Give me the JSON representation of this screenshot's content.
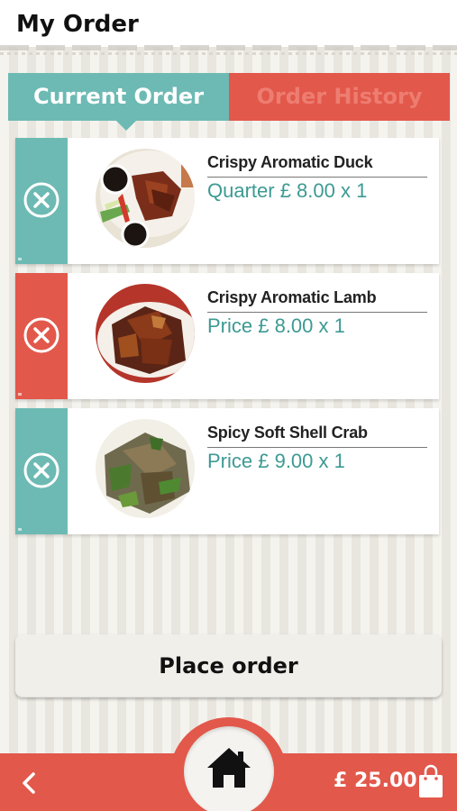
{
  "header": {
    "title": "My Order"
  },
  "tabs": {
    "current": "Current Order",
    "history": "Order History"
  },
  "orders": [
    {
      "name": "Crispy Aromatic Duck",
      "price_line": "Quarter £ 8.00 x 1",
      "accent": "#6dbab4"
    },
    {
      "name": "Crispy Aromatic Lamb",
      "price_line": "Price £ 8.00 x 1",
      "accent": "#e2584b"
    },
    {
      "name": "Spicy Soft Shell Crab",
      "price_line": "Price £ 9.00 x 1",
      "accent": "#6dbab4"
    }
  ],
  "place_order_label": "Place order",
  "footer": {
    "total": "£ 25.00",
    "back_icon": "chevron-left-icon",
    "home_icon": "home-icon",
    "bag_icon": "shopping-bag-icon"
  },
  "colors": {
    "teal": "#6dbab4",
    "red": "#e2584b",
    "price_text": "#3d9a93"
  }
}
